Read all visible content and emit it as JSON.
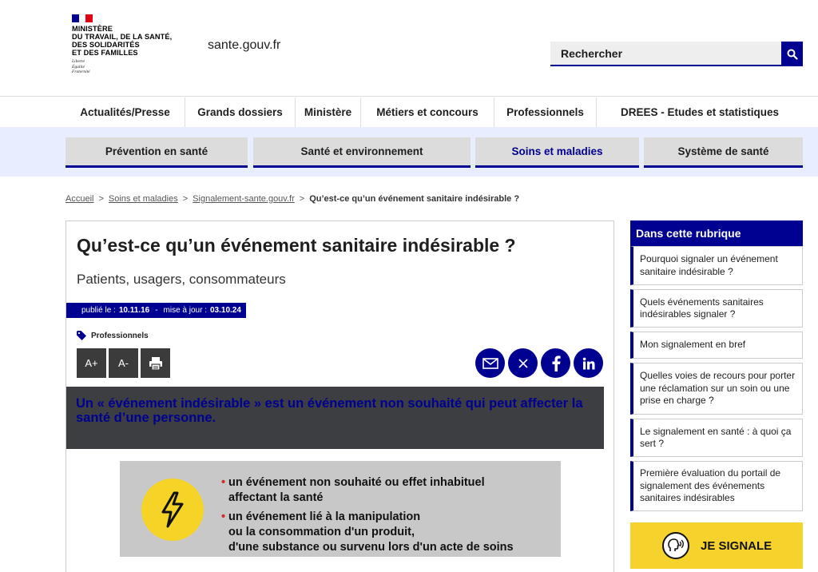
{
  "header": {
    "ministry": "MINISTÈRE\nDU TRAVAIL, DE LA SANTÉ,\nDES SOLIDARITÉS\nET DES FAMILLES",
    "motto": "Liberté\nÉgalité\nFraternité",
    "site_name": "sante.gouv.fr",
    "search_placeholder": "Rechercher",
    "colors": {
      "primary": "#000091",
      "flag_blue": "#000091",
      "flag_white": "#ffffff",
      "flag_red": "#e1000f"
    }
  },
  "main_nav": [
    "Actualités/Presse",
    "Grands dossiers",
    "Ministère",
    "Métiers et concours",
    "Professionnels",
    "DREES - Etudes et statistiques"
  ],
  "sub_nav": [
    {
      "label": "Prévention en santé",
      "active": false
    },
    {
      "label": "Santé et environnement",
      "active": false
    },
    {
      "label": "Soins et maladies",
      "active": true
    },
    {
      "label": "Système de santé",
      "active": false
    }
  ],
  "breadcrumb": {
    "items": [
      "Accueil",
      "Soins et maladies",
      "Signalement-sante.gouv.fr"
    ],
    "current": "Qu’est-ce qu’un événement sanitaire indésirable ?",
    "separator": ">"
  },
  "article": {
    "title": "Qu’est-ce qu’un événement sanitaire indésirable ?",
    "subtitle": "Patients, usagers, consommateurs",
    "published_label": "publié le :",
    "published_date": "10.11.16",
    "dash": "-",
    "updated_label": "mise à jour :",
    "updated_date": "03.10.24",
    "tag": "Professionnels",
    "tools": {
      "increase": "A+",
      "decrease": "A-"
    },
    "intro": "Un « événement indésirable » est un événement non souhaité qui peut affecter la santé d’une personne.",
    "info_items": [
      "un événement non souhaité ou effet inhabituel\naffectant la santé",
      "un événement lié à la manipulation\nou la consommation  d'un produit,\nd'une substance ou survenu lors d'un acte de soins"
    ]
  },
  "sidebar": {
    "title": "Dans cette rubrique",
    "items": [
      "Pourquoi signaler un événement sanitaire indésirable ?",
      "Quels événements sanitaires indésirables signaler ?",
      "Mon signalement en bref",
      "Quelles voies de recours pour porter une réclamation sur un soin ou une prise en charge ?",
      "Le signalement en santé : à quoi ça sert ?",
      "Première évaluation du portail de signalement des événements sanitaires indésirables"
    ],
    "cta": "JE SIGNALE"
  }
}
